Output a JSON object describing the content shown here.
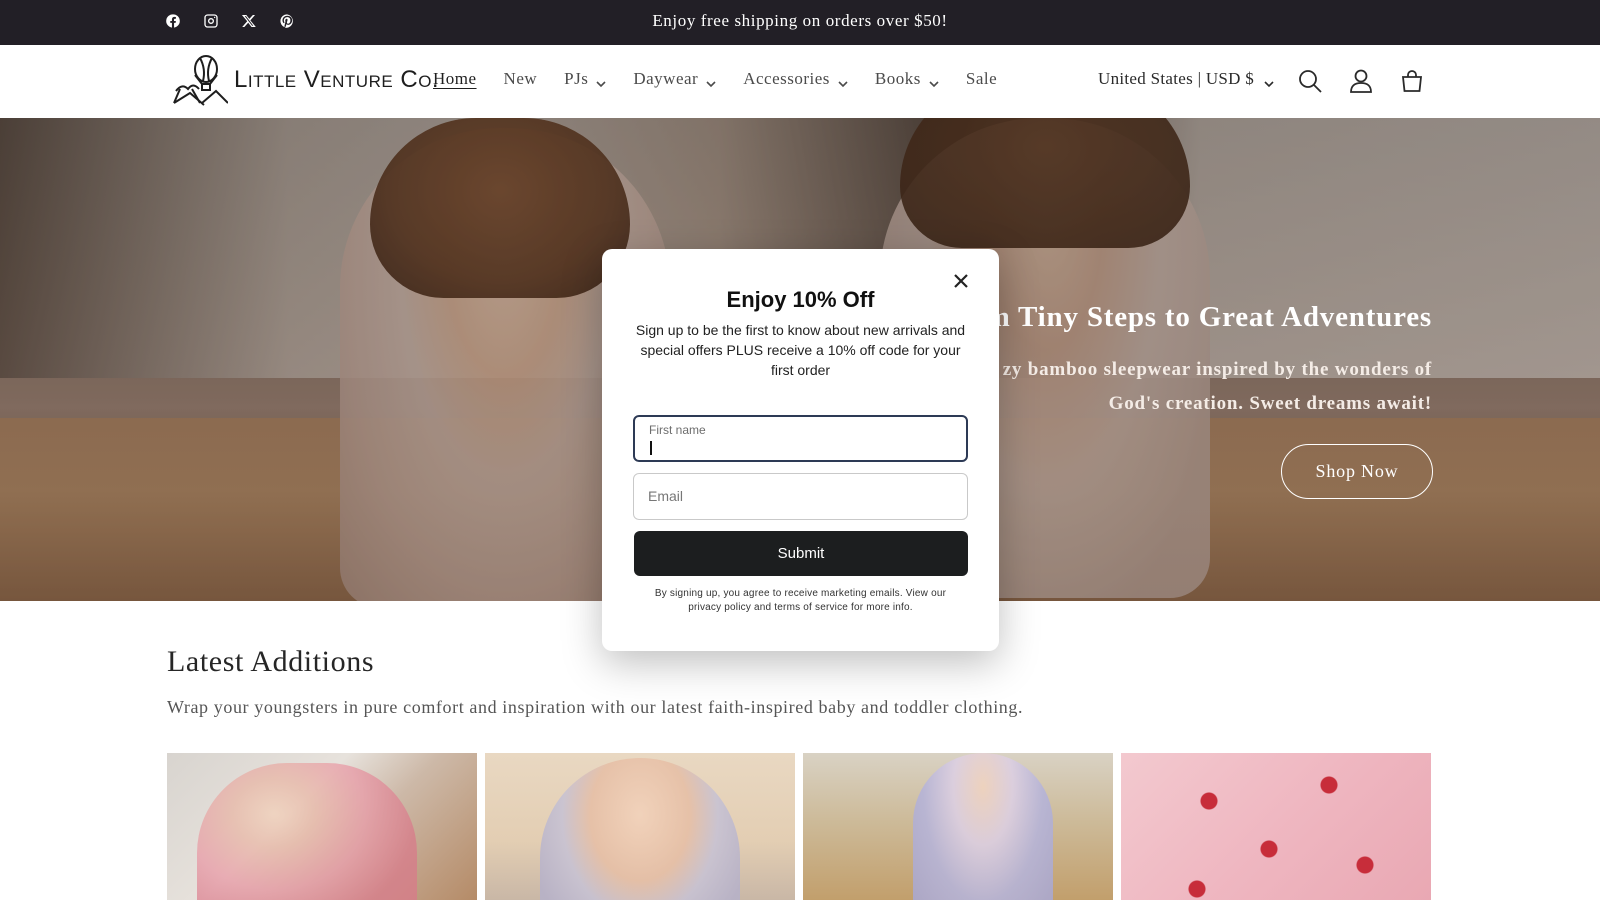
{
  "announcement": {
    "text": "Enjoy free shipping on orders over $50!",
    "social_icons": [
      "facebook-icon",
      "instagram-icon",
      "x-icon",
      "pinterest-icon"
    ]
  },
  "header": {
    "logo_text": "Little Venture Co.",
    "nav": [
      {
        "label": "Home",
        "active": true,
        "dropdown": false
      },
      {
        "label": "New",
        "active": false,
        "dropdown": false
      },
      {
        "label": "PJs",
        "active": false,
        "dropdown": true
      },
      {
        "label": "Daywear",
        "active": false,
        "dropdown": true
      },
      {
        "label": "Accessories",
        "active": false,
        "dropdown": true
      },
      {
        "label": "Books",
        "active": false,
        "dropdown": true
      },
      {
        "label": "Sale",
        "active": false,
        "dropdown": false
      }
    ],
    "country_selector": "United States | USD $",
    "icons": [
      "search-icon",
      "account-icon",
      "cart-icon"
    ]
  },
  "hero": {
    "title": "m Tiny Steps to Great Adventures",
    "subtitle": "zy bamboo sleepwear inspired by the wonders of God's creation. Sweet dreams await!",
    "button": "Shop Now"
  },
  "latest": {
    "title": "Latest Additions",
    "description": "Wrap your youngsters in pure comfort and inspiration with our latest faith-inspired baby and toddler clothing.",
    "product_count": 4
  },
  "modal": {
    "title": "Enjoy 10% Off",
    "text": "Sign up to be the first to know about new arrivals and special offers PLUS receive a 10% off code for your first order",
    "first_name_label": "First name",
    "first_name_value": "",
    "email_placeholder": "Email",
    "submit": "Submit",
    "fine_print": "By signing up, you agree to receive marketing emails. View our privacy policy and terms of service for more info."
  },
  "colors": {
    "announcement_bg": "#221f26",
    "submit_bg": "#1c1e1f",
    "focus_border": "#2d3a55"
  }
}
